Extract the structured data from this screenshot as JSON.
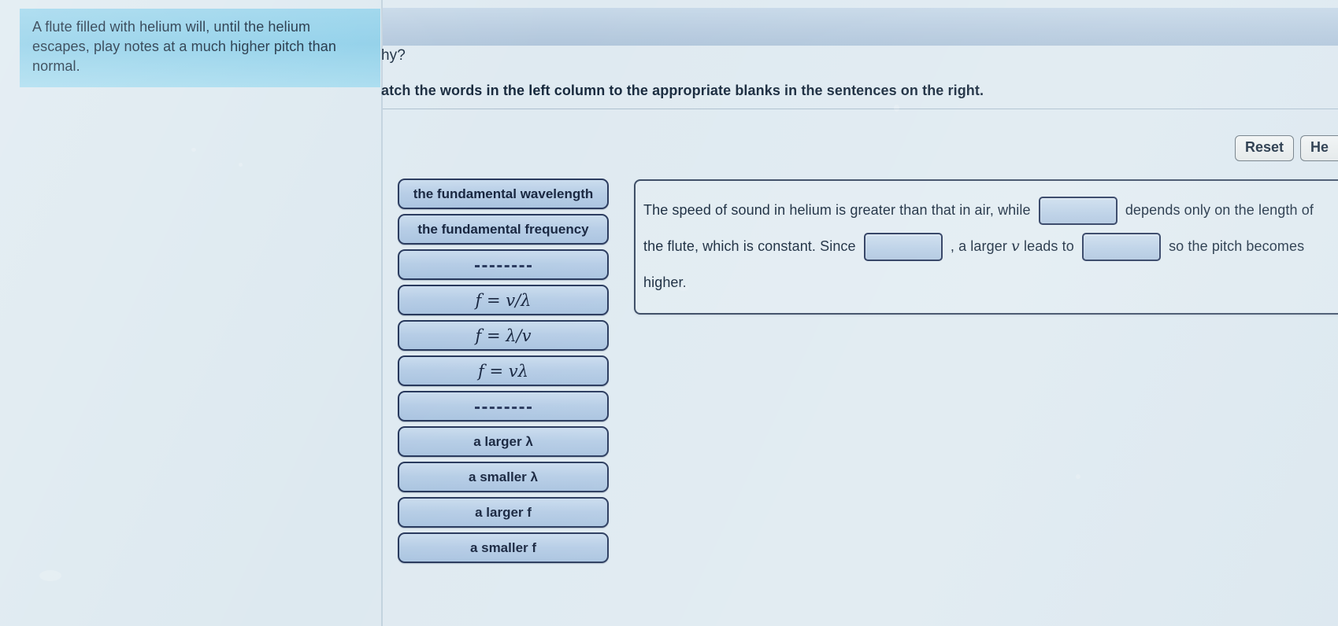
{
  "hint_popup": {
    "text": "A flute filled with helium will, until the helium escapes, play notes at a much higher pitch than normal."
  },
  "header": {
    "question_tail": "hy?",
    "instruction": "atch the words in the left column to the appropriate blanks in the sentences on the right."
  },
  "toolbar": {
    "reset_label": "Reset",
    "help_label": "He"
  },
  "tiles": [
    {
      "label": "the fundamental wavelength",
      "type": "text"
    },
    {
      "label": "the fundamental frequency",
      "type": "text"
    },
    {
      "label": "",
      "type": "dash"
    },
    {
      "label": "f = v/λ",
      "type": "math"
    },
    {
      "label": "f = λ/v",
      "type": "math"
    },
    {
      "label": "f = vλ",
      "type": "math"
    },
    {
      "label": "",
      "type": "dash"
    },
    {
      "label": "a larger λ",
      "type": "text"
    },
    {
      "label": "a smaller λ",
      "type": "text"
    },
    {
      "label": "a larger f",
      "type": "text"
    },
    {
      "label": "a smaller f",
      "type": "text"
    }
  ],
  "sentence": {
    "part1": "The speed of sound in helium is greater than that in air, while",
    "part2": "depends only on the",
    "part3": "length of the flute, which is constant. Since",
    "part4": ", a larger",
    "part4_var": "v",
    "part5": "leads to",
    "part6": "so the",
    "part7": "pitch becomes higher.",
    "blank1_value": "",
    "blank2_value": "",
    "blank3_value": ""
  },
  "colors": {
    "page_background": "#dde8ef",
    "tile_fill": "#b6cde6",
    "tile_border": "#27385c",
    "hint_background": "#8ecfe9",
    "banner": "#b8cce0"
  }
}
